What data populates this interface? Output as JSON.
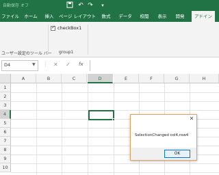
{
  "titlebar": {
    "autosave_label": "自動保存",
    "autosave_state": "オフ",
    "icons": [
      "save-icon",
      "undo-icon",
      "redo-icon",
      "customize-qat-icon"
    ]
  },
  "tabs": [
    {
      "label": "ファイル",
      "active": false
    },
    {
      "label": "ホーム",
      "active": false
    },
    {
      "label": "挿入",
      "active": false
    },
    {
      "label": "ページ レイアウト",
      "active": false
    },
    {
      "label": "数式",
      "active": false
    },
    {
      "label": "データ",
      "active": false
    },
    {
      "label": "校閲",
      "active": false
    },
    {
      "label": "表示",
      "active": false
    },
    {
      "label": "開発",
      "active": false
    },
    {
      "label": "アドイン",
      "active": true
    }
  ],
  "ribbon": {
    "checkbox_label": "checkBox1",
    "checkbox_checked": true,
    "checkmark": "✓",
    "group_user_label": "ユーザー設定のツール バー",
    "group1_label": "group1"
  },
  "formula_bar": {
    "name_box": "D4",
    "name_box_arrow": "▼",
    "dots": "⋮",
    "cancel": "✕",
    "enter": "✓",
    "fx": "fx",
    "formula": ""
  },
  "grid": {
    "columns": [
      "A",
      "B",
      "C",
      "D",
      "E",
      "F",
      "G",
      "H"
    ],
    "rows": [
      "1",
      "2",
      "3",
      "4",
      "5",
      "6",
      "7",
      "8",
      "9",
      "10"
    ],
    "active_cell": "D4",
    "accent": "#217346"
  },
  "dialog": {
    "close": "✕",
    "message": "SelectionChanged col4,row4",
    "ok_label": "OK"
  }
}
